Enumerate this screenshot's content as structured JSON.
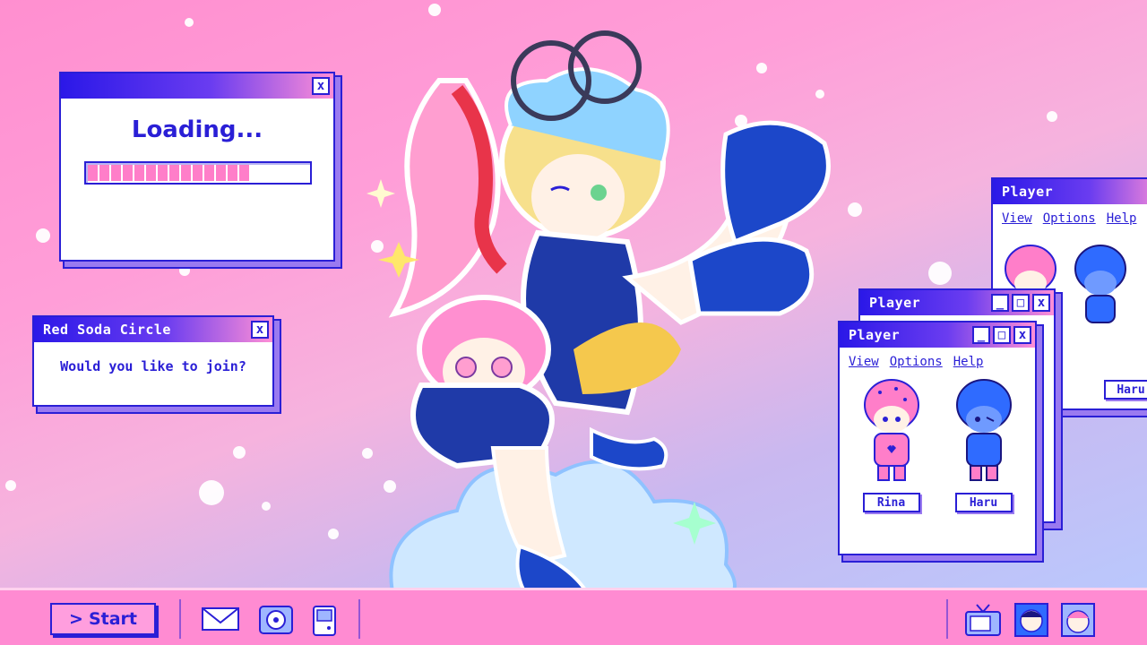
{
  "loading_window": {
    "text": "Loading...",
    "close_label": "x",
    "progress": 0.76
  },
  "soda_window": {
    "title": "Red Soda Circle",
    "close_label": "x",
    "message": "Would you like to join?"
  },
  "player_windows": {
    "title": "Player",
    "menu": [
      "View",
      "Options",
      "Help"
    ],
    "characters": [
      {
        "name": "Rina",
        "color": "#ff7ec9"
      },
      {
        "name": "Haru",
        "color": "#2f6bff"
      }
    ],
    "back_partial_name": "Haru"
  },
  "taskbar": {
    "start_label": "Start",
    "start_glyph": ">",
    "icons": [
      "mail-icon",
      "cd-player-icon",
      "gameboy-icon",
      "tv-icon",
      "avatar-haru-icon",
      "avatar-rina-icon"
    ]
  },
  "colors": {
    "accent": "#2a1fd6",
    "pink": "#ff8bd2",
    "progress_fill": "#ff7ec9"
  }
}
